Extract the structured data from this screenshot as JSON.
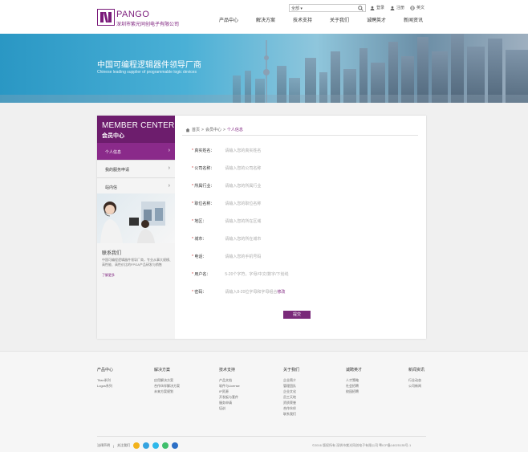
{
  "header": {
    "logo_en": "PANGO",
    "logo_cn": "深圳市紫光同创电子有限公司",
    "search_scope": "全部 ▾",
    "login": "登录",
    "register": "注册",
    "language": "英文",
    "nav": [
      "产品中心",
      "解决方案",
      "技术支持",
      "关于我们",
      "诚聘英才",
      "新闻资讯"
    ]
  },
  "banner": {
    "title": "中国可编程逻辑器件领导厂商",
    "subtitle": "Chinese leading supplier of programmable logic devices"
  },
  "sidebar": {
    "title_en": "MEMBER CENTER",
    "title_cn": "会员中心",
    "items": [
      {
        "label": "个人信息",
        "active": true
      },
      {
        "label": "我的服务申请",
        "active": false
      },
      {
        "label": "站内信",
        "active": false
      }
    ],
    "contact_title": "联系我们",
    "contact_text": "中国可编程逻辑器件领导厂商，专业从事大规模、高性能、高性价比的FPGA产品研发与销售",
    "contact_more": "了解更多"
  },
  "breadcrumb": {
    "home": "首页",
    "sep": ">",
    "level1": "会员中心",
    "current": "个人信息"
  },
  "form": {
    "fields": [
      {
        "label": "真实姓名：",
        "placeholder": "请输入您的真实姓名"
      },
      {
        "label": "公司名称：",
        "placeholder": "请输入您的公司名称"
      },
      {
        "label": "所属行业：",
        "placeholder": "请输入您的所属行业"
      },
      {
        "label": "职位名称：",
        "placeholder": "请输入您的职位名称"
      },
      {
        "label": "地区：",
        "placeholder": "请输入您的所在区域"
      },
      {
        "label": "城市：",
        "placeholder": "请输入您的所在城市"
      },
      {
        "label": "电话：",
        "placeholder": "请输入您的手机号码"
      },
      {
        "label": "用户名：",
        "placeholder": "5-20个字符，字母/中文/数字/下划线"
      },
      {
        "label": "密码：",
        "placeholder": "请输入8-20位字母和字母组合",
        "edit": "修改"
      }
    ],
    "submit": "提交"
  },
  "footer": {
    "columns": [
      {
        "title": "产品中心",
        "items": [
          "Titan系列",
          "Logos系列"
        ]
      },
      {
        "title": "解决方案",
        "items": [
          "应用解决方案",
          "合作伙伴解决方案",
          "未来方案规划"
        ]
      },
      {
        "title": "技术支持",
        "items": [
          "产品文档",
          "软件与License",
          "IP资源",
          "开发板与套件",
          "服务申请",
          "培训"
        ]
      },
      {
        "title": "关于我们",
        "items": [
          "企业简介",
          "管理团队",
          "企业文化",
          "员工天地",
          "资质荣誉",
          "合作伙伴",
          "联系我们"
        ]
      },
      {
        "title": "诚聘英才",
        "items": [
          "人才策略",
          "社会招聘",
          "校园招聘"
        ]
      },
      {
        "title": "新闻资讯",
        "items": [
          "行业动态",
          "公司新闻"
        ]
      }
    ],
    "legal": "法律声明",
    "follow": "关注我们",
    "copyright": "©2016 版权所有 深圳市紫光同创电子有限公司 粤ICP备14025135号-1",
    "social_colors": [
      "#f2b21b",
      "#35a3e0",
      "#2fb8ea",
      "#3fbf6c",
      "#2c6fc6"
    ],
    "accent": "#7a1a7a"
  }
}
